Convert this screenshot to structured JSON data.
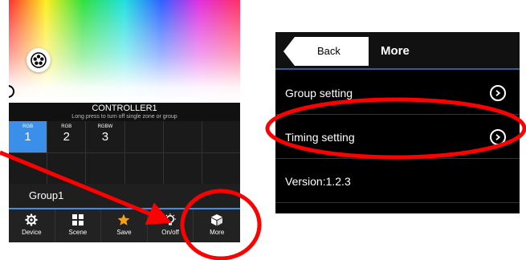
{
  "left_app": {
    "controller": {
      "title": "CONTROLLER1",
      "subtitle": "Long press to turn off single zone or group"
    },
    "zones": [
      {
        "type": "RGB",
        "number": "1",
        "active": true
      },
      {
        "type": "RGB",
        "number": "2",
        "active": false
      },
      {
        "type": "RGBW",
        "number": "3",
        "active": false
      }
    ],
    "group_name": "Group1",
    "tabs": [
      {
        "label": "Device",
        "icon": "gear-icon"
      },
      {
        "label": "Scene",
        "icon": "grid-icon"
      },
      {
        "label": "Save",
        "icon": "star-icon"
      },
      {
        "label": "On/off",
        "icon": "bulb-icon"
      },
      {
        "label": "More",
        "icon": "cube-icon"
      }
    ]
  },
  "right_app": {
    "back_label": "Back",
    "title": "More",
    "rows": [
      {
        "label": "Group setting",
        "has_chevron": true
      },
      {
        "label": "Timing setting",
        "has_chevron": true
      },
      {
        "label": "Version:1.2.3",
        "has_chevron": false
      }
    ]
  },
  "colors": {
    "accent_blue": "#3a8fe8",
    "annotation_red": "#ff0000"
  }
}
